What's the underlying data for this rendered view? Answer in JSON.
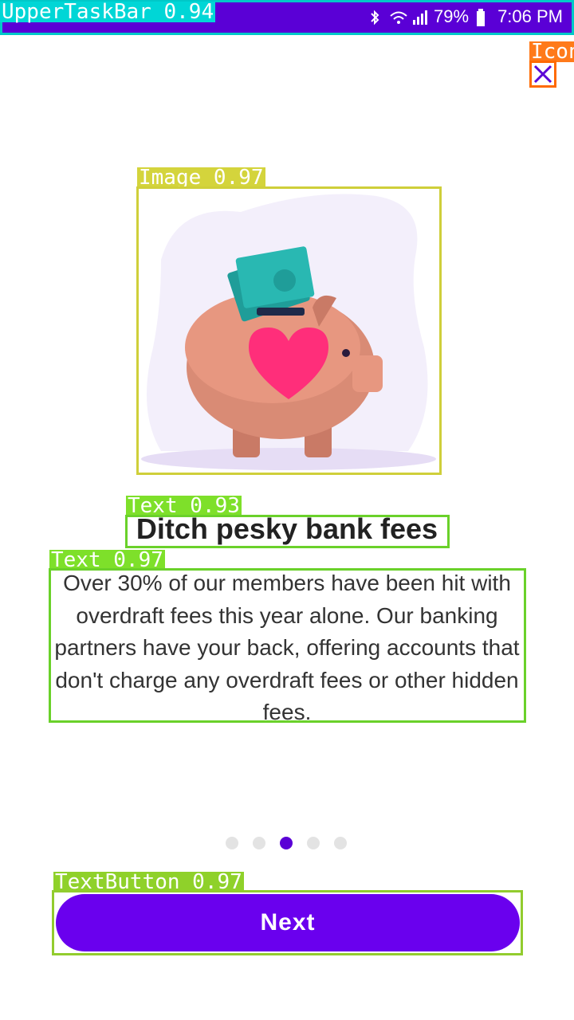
{
  "status_bar": {
    "battery": "79%",
    "time": "7:06 PM",
    "icons": [
      "bluetooth-icon",
      "wifi-icon",
      "signal-icon",
      "battery-icon"
    ]
  },
  "detections": {
    "upper_task_bar": "UpperTaskBar 0.94",
    "icon": "Icon",
    "image": "Image 0.97",
    "title_text": "Text 0.93",
    "body_text": "Text 0.97",
    "text_button": "TextButton 0.97"
  },
  "content": {
    "title": "Ditch pesky bank fees",
    "body": "Over 30% of our members have been hit with overdraft fees this year alone. Our banking partners have your back, offering accounts that don't charge any overdraft fees or other hidden fees."
  },
  "pager": {
    "count": 5,
    "active_index": 2
  },
  "buttons": {
    "next": "Next"
  },
  "colors": {
    "accent": "#6a00ee",
    "status_bar": "#5a00d6"
  }
}
